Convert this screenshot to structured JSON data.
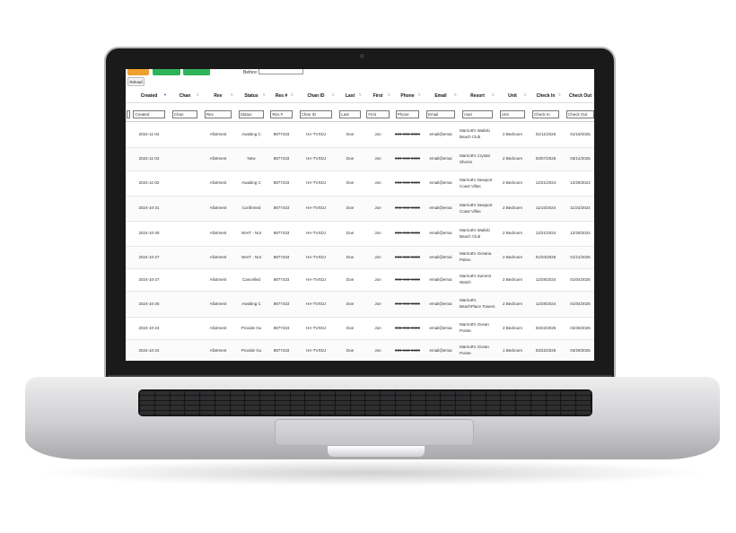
{
  "toolbar": {
    "btn_orange": "",
    "btn_green1": "",
    "btn_green2": "",
    "before_label": "Before:",
    "before_value": "",
    "reload_label": "Reload"
  },
  "columns": [
    "",
    "Created",
    "Chan",
    "Rev",
    "Status",
    "Res #",
    "Chan ID",
    "Last",
    "First",
    "Phone",
    "Email",
    "Resort",
    "Unit",
    "Check In",
    "Check Out"
  ],
  "filters": [
    "",
    "Created",
    "Chan",
    "Rev",
    "Status",
    "Res #",
    "Chan ID",
    "Last",
    "First",
    "Phone",
    "Email",
    "mari",
    "Unit",
    "Check In",
    "Check Out"
  ],
  "sort_active_column": "Created",
  "rows": [
    {
      "created": "2024-11-04",
      "chan": "",
      "rev": "Allotment",
      "status": "Awaiting C",
      "res": "8877433",
      "chan_id": "HA-TVXDJ",
      "last": "Doe",
      "first": "Jon",
      "phone": "999-999-9999",
      "email": "email@emai",
      "resort": "Marriott's Waikiki Beach Club",
      "unit": "2 Bedroom",
      "check_in": "01/11/2025",
      "check_out": "01/18/2025"
    },
    {
      "created": "2024-11-03",
      "chan": "",
      "rev": "Allotment",
      "status": "New",
      "res": "8877433",
      "chan_id": "HA-TVXDJ",
      "last": "Doe",
      "first": "Jon",
      "phone": "999-999-9999",
      "email": "email@emai",
      "resort": "Marriott's Crystal Shores",
      "unit": "2 Bedroom",
      "check_in": "03/07/2025",
      "check_out": "03/14/2025"
    },
    {
      "created": "2024-11-02",
      "chan": "",
      "rev": "Allotment",
      "status": "Awaiting C",
      "res": "8877433",
      "chan_id": "HA-TVXDJ",
      "last": "Doe",
      "first": "Jon",
      "phone": "999-999-9999",
      "email": "email@emai",
      "resort": "Marriott's Newport Coast Villas",
      "unit": "2 Bedroom",
      "check_in": "12/21/2024",
      "check_out": "12/28/2024"
    },
    {
      "created": "2024-10-31",
      "chan": "",
      "rev": "Allotment",
      "status": "Confirmed",
      "res": "8877433",
      "chan_id": "HA-TVXDJ",
      "last": "Doe",
      "first": "Jon",
      "phone": "999-999-9999",
      "email": "email@emai",
      "resort": "Marriott's Newport Coast Villas",
      "unit": "2 Bedroom",
      "check_in": "11/15/2024",
      "check_out": "11/22/2024"
    },
    {
      "created": "2024-10-28",
      "chan": "",
      "rev": "Allotment",
      "status": "WAIT - Not",
      "res": "8877433",
      "chan_id": "HA-TVXDJ",
      "last": "Doe",
      "first": "Jon",
      "phone": "999-999-9999",
      "email": "email@emai",
      "resort": "Marriott's Waikiki Beach Club",
      "unit": "2 Bedroom",
      "check_in": "12/21/2024",
      "check_out": "12/28/2024"
    },
    {
      "created": "2024-10-27",
      "chan": "",
      "rev": "Allotment",
      "status": "WAIT - Not",
      "res": "8877433",
      "chan_id": "HA-TVXDJ",
      "last": "Doe",
      "first": "Jon",
      "phone": "999-999-9999",
      "email": "email@emai",
      "resort": "Marriott's Oceana Palms",
      "unit": "2 Bedroom",
      "check_in": "01/04/2025",
      "check_out": "01/11/2025"
    },
    {
      "created": "2024-10-27",
      "chan": "",
      "rev": "Allotment",
      "status": "Cancelled",
      "res": "8877433",
      "chan_id": "HA-TVXDJ",
      "last": "Doe",
      "first": "Jon",
      "phone": "999-999-9999",
      "email": "email@emai",
      "resort": "Marriott's Summit Watch",
      "unit": "2 Bedroom",
      "check_in": "12/28/2024",
      "check_out": "01/04/2025"
    },
    {
      "created": "2024-10-25",
      "chan": "",
      "rev": "Allotment",
      "status": "Awaiting C",
      "res": "8877433",
      "chan_id": "HA-TVXDJ",
      "last": "Doe",
      "first": "Jon",
      "phone": "999-999-9999",
      "email": "email@emai",
      "resort": "Marriott's BeachPlace Towers",
      "unit": "2 Bedroom",
      "check_in": "12/28/2024",
      "check_out": "01/04/2025"
    },
    {
      "created": "2024-10-24",
      "chan": "",
      "rev": "Allotment",
      "status": "Provide Gu",
      "res": "8877433",
      "chan_id": "HA-TVXDJ",
      "last": "Doe",
      "first": "Jon",
      "phone": "999-999-9999",
      "email": "email@emai",
      "resort": "Marriott's Ocean Pointe",
      "unit": "2 Bedroom",
      "check_in": "03/22/2025",
      "check_out": "03/28/2025"
    },
    {
      "created": "2024-10-24",
      "chan": "",
      "rev": "Allotment",
      "status": "Provide Gu",
      "res": "8877433",
      "chan_id": "HA-TVXDJ",
      "last": "Doe",
      "first": "Jon",
      "phone": "999-999-9999",
      "email": "email@emai",
      "resort": "Marriott's Ocean Pointe",
      "unit": "1 Bedroom",
      "check_in": "03/22/2025",
      "check_out": "03/29/2025"
    }
  ]
}
